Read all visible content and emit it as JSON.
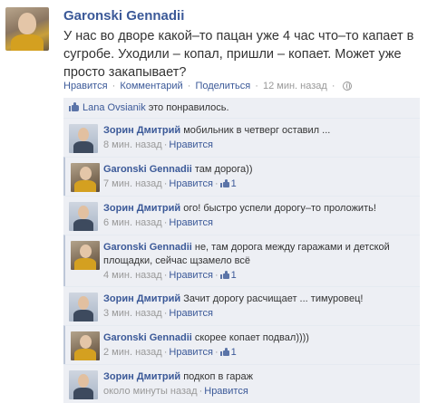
{
  "post": {
    "author": "Garonski Gennadii",
    "text": "У нас во дворе какой–то пацан уже 4 час что–то капает в сугробе. Уходили – копал, пришли – копает. Может уже просто закапывает?",
    "actions": {
      "like": "Нравится",
      "comment": "Комментарий",
      "share": "Поделиться",
      "time": "12 мин. назад"
    }
  },
  "likes": {
    "user": "Lana Ovsianik",
    "text": " это понравилось."
  },
  "comments": [
    {
      "author": "Зорин Дмитрий",
      "text": " мобильник в четверг оставил ...",
      "time": "8 мин. назад",
      "like": "Нравится",
      "count": ""
    },
    {
      "author": "Garonski Gennadii",
      "text": " там дорога))",
      "time": "7 мин. назад",
      "like": "Нравится",
      "count": "1"
    },
    {
      "author": "Зорин Дмитрий",
      "text": " ого! быстро успели дорогу–то проложить!",
      "time": "6 мин. назад",
      "like": "Нравится",
      "count": ""
    },
    {
      "author": "Garonski Gennadii",
      "text": " не, там дорога между гаражами и детской площадки, сейчас щзамело всё",
      "time": "4 мин. назад",
      "like": "Нравится",
      "count": "1"
    },
    {
      "author": "Зорин Дмитрий",
      "text": " Зачит дорогу расчищает ... тимуровец!",
      "time": "3 мин. назад",
      "like": "Нравится",
      "count": ""
    },
    {
      "author": "Garonski Gennadii",
      "text": " скорее копает подвал))))",
      "time": "2 мин. назад",
      "like": "Нравится",
      "count": "1"
    },
    {
      "author": "Зорин Дмитрий",
      "text": " подкоп в гараж",
      "time": "около минуты назад",
      "like": "Нравится",
      "count": ""
    }
  ],
  "separators": {
    "dot": "·"
  },
  "colors": {
    "link": "#3b5998",
    "comment_bg": "#edeff4",
    "meta": "#999999"
  },
  "icons": {
    "audience": "globe-icon",
    "like": "thumbs-up-icon"
  }
}
